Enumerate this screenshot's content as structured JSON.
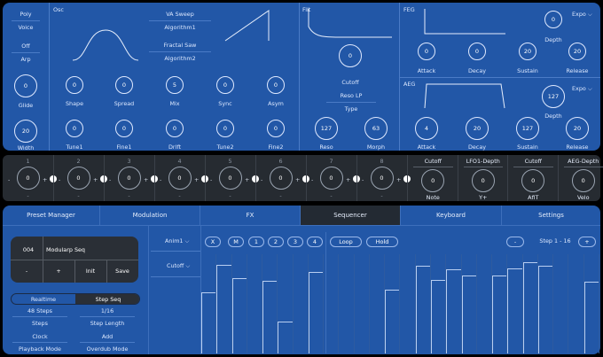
{
  "left": {
    "poly": "Poly",
    "voice": "Voice",
    "off": "Off",
    "arp": "Arp",
    "glide_val": "0",
    "glide": "Glide",
    "width_val": "20",
    "width": "Width"
  },
  "osc": {
    "title": "Osc",
    "algo1_value": "VA Sweep",
    "algo1_label": "Algorithm1",
    "algo2_value": "Fractal Saw",
    "algo2_label": "Algorithm2",
    "row1": [
      {
        "label": "Shape",
        "val": "0"
      },
      {
        "label": "Spread",
        "val": "0"
      },
      {
        "label": "Mix",
        "val": "5"
      },
      {
        "label": "Sync",
        "val": "0"
      },
      {
        "label": "Asym",
        "val": "0"
      }
    ],
    "row2": [
      {
        "label": "Tune1",
        "val": "0"
      },
      {
        "label": "Fine1",
        "val": "0"
      },
      {
        "label": "Drift",
        "val": "0"
      },
      {
        "label": "Tune2",
        "val": "0"
      },
      {
        "label": "Fine2",
        "val": "0"
      }
    ]
  },
  "filt": {
    "title": "Filt",
    "cutoff_val": "0",
    "cutoff": "Cutoff",
    "type_value": "Reso LP",
    "type": "Type",
    "reso_val": "127",
    "reso": "Reso",
    "morph_val": "63",
    "morph": "Morph"
  },
  "feg": {
    "title": "FEG",
    "expo": "Expo",
    "depth_val": "0",
    "depth": "Depth",
    "attack_val": "0",
    "decay_val": "0",
    "sustain_val": "20",
    "release_val": "20",
    "attack": "Attack",
    "decay": "Decay",
    "sustain": "Sustain",
    "release": "Release"
  },
  "aeg": {
    "title": "AEG",
    "expo": "Expo",
    "depth_val": "127",
    "depth": "Depth",
    "attack_val": "4",
    "decay_val": "20",
    "sustain_val": "127",
    "release_val": "20",
    "attack": "Attack",
    "decay": "Decay",
    "sustain": "Sustain",
    "release": "Release"
  },
  "mod": {
    "slots": [
      {
        "num": "1",
        "val": "0"
      },
      {
        "num": "2",
        "val": "0"
      },
      {
        "num": "3",
        "val": "0"
      },
      {
        "num": "4",
        "val": "0"
      },
      {
        "num": "5",
        "val": "0"
      },
      {
        "num": "6",
        "val": "0"
      },
      {
        "num": "7",
        "val": "0"
      },
      {
        "num": "8",
        "val": "0"
      }
    ],
    "minus": "-",
    "plus": "+",
    "targets": [
      {
        "top": "Cutoff",
        "val": "0",
        "bottom": "Note"
      },
      {
        "top": "LFO1-Depth",
        "val": "0",
        "bottom": "Y+"
      },
      {
        "top": "Cutoff",
        "val": "0",
        "bottom": "AfiT"
      },
      {
        "top": "AEG-Depth",
        "val": "0",
        "bottom": "Velo"
      }
    ]
  },
  "tabs": [
    "Preset Manager",
    "Modulation",
    "FX",
    "Sequencer",
    "Keyboard",
    "Settings"
  ],
  "preset": {
    "num": "004",
    "name": "Modularp Seq",
    "minus": "-",
    "plus": "+",
    "init": "Init",
    "save": "Save"
  },
  "seq": {
    "realtime": "Realtime",
    "stepseq": "Step Seq",
    "steps_val": "48 Steps",
    "steps": "Steps",
    "steplen_val": "1/16",
    "steplen": "Step Length",
    "clock": "Clock",
    "add": "Add",
    "playback": "Playback Mode",
    "overdub": "Overdub Mode",
    "anim": "Anim1",
    "cutoff": "Cutoff",
    "btn_x": "X",
    "btn_m": "M",
    "btn_1": "1",
    "btn_2": "2",
    "btn_3": "3",
    "btn_4": "4",
    "loop": "Loop",
    "hold": "Hold",
    "minus": "-",
    "plus": "+",
    "range": "Step 1 - 16",
    "levels": [
      0.62,
      0.89,
      0.76,
      0.0,
      0.73,
      0.32,
      0.0,
      0.82,
      0.0,
      0.0,
      0.0,
      0.0,
      0.64,
      0.0,
      0.88,
      0.74,
      0.85,
      0.79,
      0.0,
      0.79,
      0.86,
      0.92,
      0.88,
      0.0,
      0.0,
      0.72
    ]
  }
}
